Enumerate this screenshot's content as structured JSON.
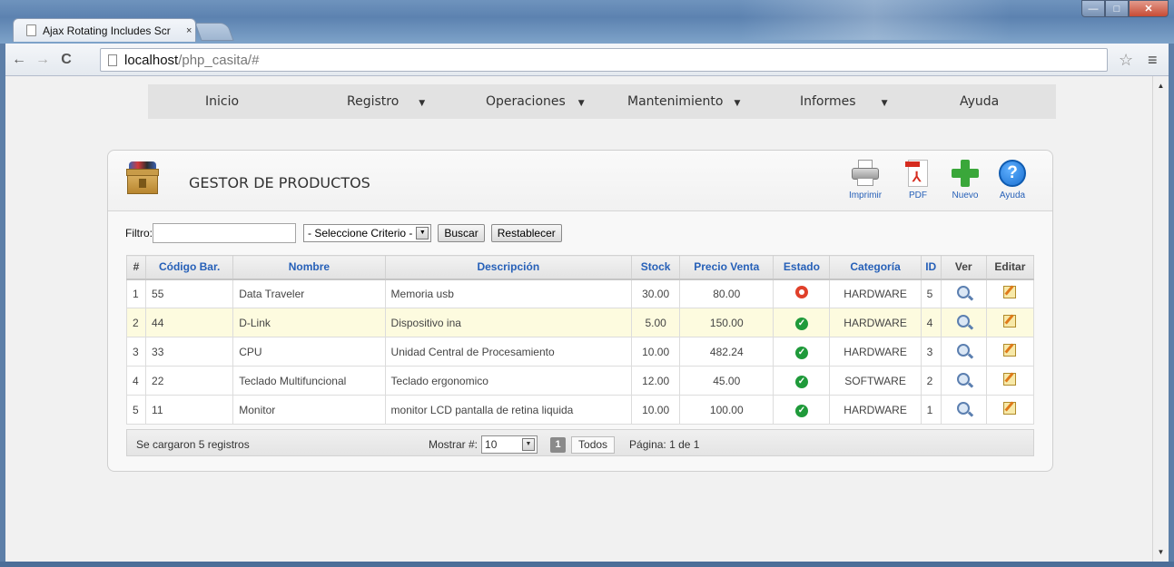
{
  "browser": {
    "tab_title": "Ajax Rotating Includes Scr",
    "tab_close": "×",
    "address_host": "localhost",
    "address_path": "/php_casita/#"
  },
  "menu": [
    {
      "label": "Inicio",
      "caret": ""
    },
    {
      "label": "Registro",
      "caret": "▼"
    },
    {
      "label": "Operaciones",
      "caret": "▼"
    },
    {
      "label": "Mantenimiento",
      "caret": "▼"
    },
    {
      "label": "Informes",
      "caret": "▼"
    },
    {
      "label": "Ayuda",
      "caret": ""
    }
  ],
  "panel": {
    "title": "GESTOR DE PRODUCTOS",
    "tools": {
      "print": "Imprimir",
      "pdf": "PDF",
      "new": "Nuevo",
      "help": "Ayuda"
    }
  },
  "filter": {
    "label": "Filtro:",
    "value": "",
    "criterio": "- Seleccione Criterio -",
    "buscar": "Buscar",
    "restablecer": "Restablecer"
  },
  "table": {
    "headers": [
      "#",
      "Código Bar.",
      "Nombre",
      "Descripción",
      "Stock",
      "Precio Venta",
      "Estado",
      "Categoría",
      "ID",
      "Ver",
      "Editar"
    ],
    "rows": [
      {
        "n": "1",
        "codigo": "55",
        "nombre": "Data Traveler",
        "descripcion": "Memoria usb",
        "stock": "30.00",
        "precio": "80.00",
        "estado": "inactive",
        "categoria": "HARDWARE",
        "id": "5"
      },
      {
        "n": "2",
        "codigo": "44",
        "nombre": "D-Link",
        "descripcion": "Dispositivo ina",
        "stock": "5.00",
        "precio": "150.00",
        "estado": "active",
        "categoria": "HARDWARE",
        "id": "4"
      },
      {
        "n": "3",
        "codigo": "33",
        "nombre": "CPU",
        "descripcion": "Unidad Central de Procesamiento",
        "stock": "10.00",
        "precio": "482.24",
        "estado": "active",
        "categoria": "HARDWARE",
        "id": "3"
      },
      {
        "n": "4",
        "codigo": "22",
        "nombre": "Teclado Multifuncional",
        "descripcion": "Teclado ergonomico",
        "stock": "12.00",
        "precio": "45.00",
        "estado": "active",
        "categoria": "SOFTWARE",
        "id": "2"
      },
      {
        "n": "5",
        "codigo": "11",
        "nombre": "Monitor",
        "descripcion": "monitor LCD pantalla de retina liquida",
        "stock": "10.00",
        "precio": "100.00",
        "estado": "active",
        "categoria": "HARDWARE",
        "id": "1"
      }
    ],
    "highlight_row": 2
  },
  "footer": {
    "count": "Se cargaron 5 registros",
    "mostrar_label": "Mostrar #:",
    "mostrar_value": "10",
    "current_page": "1",
    "todos": "Todos",
    "pagina": "Página: 1 de 1"
  },
  "colors": {
    "link_blue": "#2660b8",
    "ok_green": "#1f9a3a",
    "off_red": "#e0402a",
    "highlight_row": "#fdfbdf"
  }
}
